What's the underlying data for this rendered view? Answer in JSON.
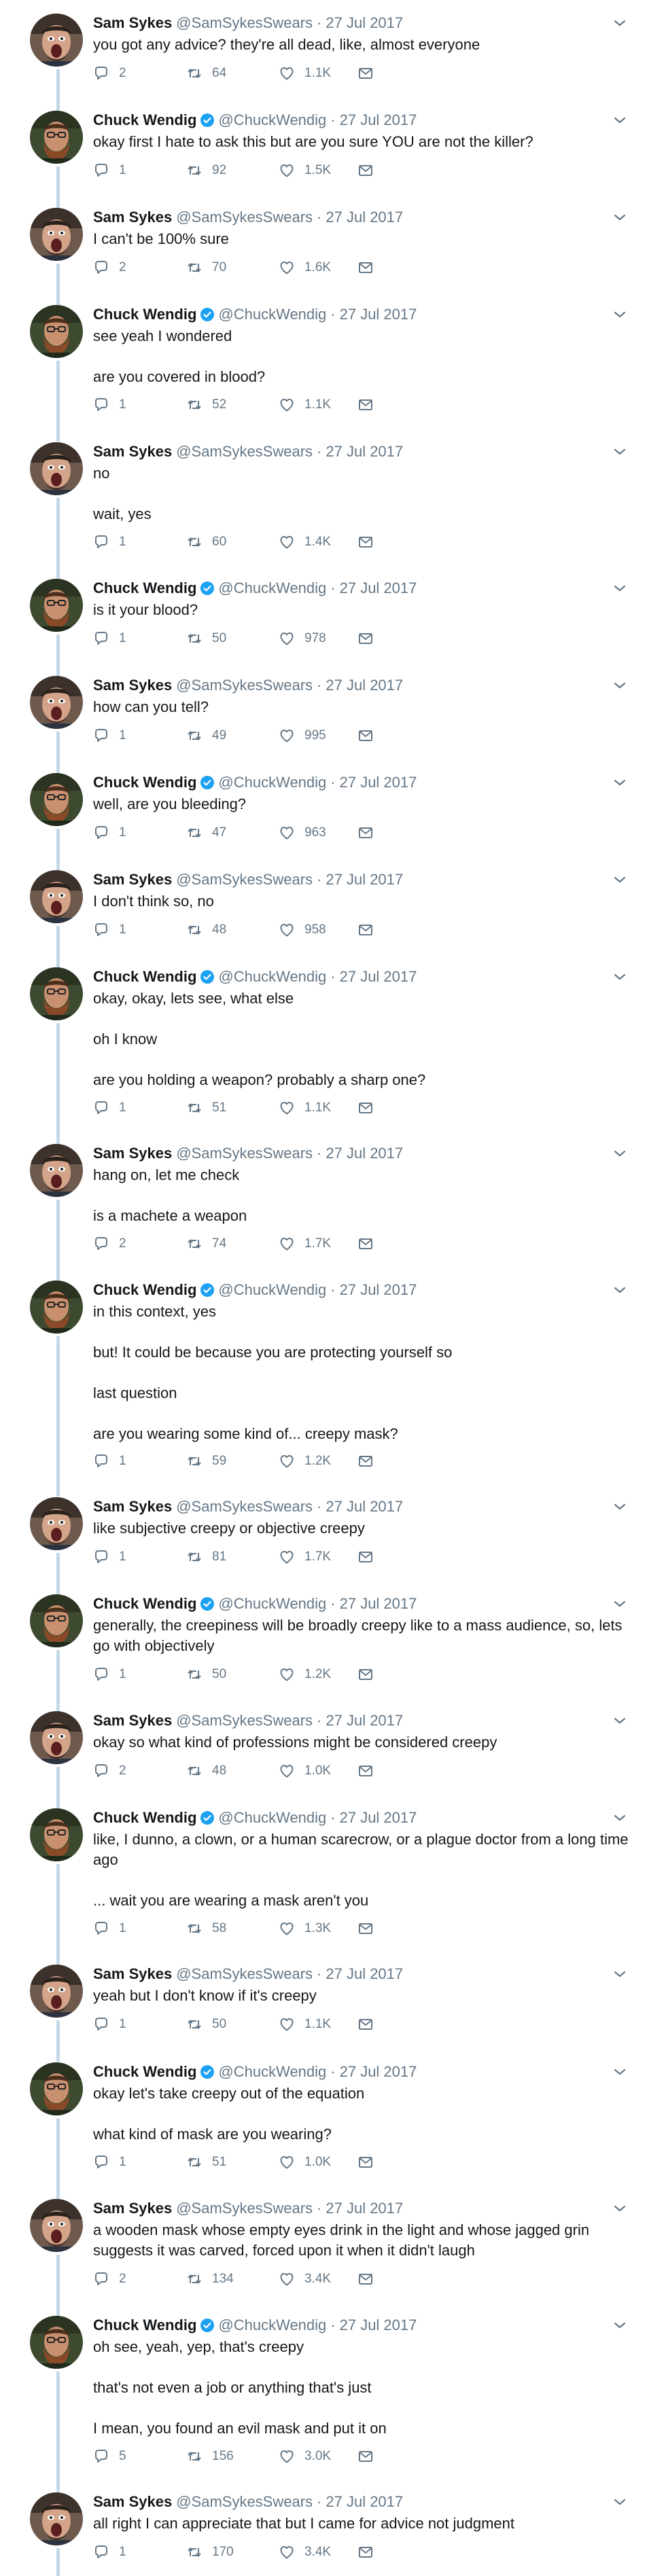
{
  "tweets": [
    {
      "author": "sam",
      "name": "Sam Sykes",
      "handle": "@SamSykesSwears",
      "date": "27 Jul 2017",
      "text": [
        "you got any advice? they're all dead, like, almost everyone"
      ],
      "replies": "2",
      "retweets": "64",
      "likes": "1.1K"
    },
    {
      "author": "chuck",
      "name": "Chuck Wendig",
      "handle": "@ChuckWendig",
      "date": "27 Jul 2017",
      "text": [
        "okay first I hate to ask this but are you sure YOU are not the killer?"
      ],
      "replies": "1",
      "retweets": "92",
      "likes": "1.5K"
    },
    {
      "author": "sam",
      "name": "Sam Sykes",
      "handle": "@SamSykesSwears",
      "date": "27 Jul 2017",
      "text": [
        "I can't be 100% sure"
      ],
      "replies": "2",
      "retweets": "70",
      "likes": "1.6K"
    },
    {
      "author": "chuck",
      "name": "Chuck Wendig",
      "handle": "@ChuckWendig",
      "date": "27 Jul 2017",
      "text": [
        "see yeah I wondered",
        "are you covered in blood?"
      ],
      "replies": "1",
      "retweets": "52",
      "likes": "1.1K"
    },
    {
      "author": "sam",
      "name": "Sam Sykes",
      "handle": "@SamSykesSwears",
      "date": "27 Jul 2017",
      "text": [
        "no",
        "wait, yes"
      ],
      "replies": "1",
      "retweets": "60",
      "likes": "1.4K"
    },
    {
      "author": "chuck",
      "name": "Chuck Wendig",
      "handle": "@ChuckWendig",
      "date": "27 Jul 2017",
      "text": [
        "is it your blood?"
      ],
      "replies": "1",
      "retweets": "50",
      "likes": "978"
    },
    {
      "author": "sam",
      "name": "Sam Sykes",
      "handle": "@SamSykesSwears",
      "date": "27 Jul 2017",
      "text": [
        "how can you tell?"
      ],
      "replies": "1",
      "retweets": "49",
      "likes": "995"
    },
    {
      "author": "chuck",
      "name": "Chuck Wendig",
      "handle": "@ChuckWendig",
      "date": "27 Jul 2017",
      "text": [
        "well, are you bleeding?"
      ],
      "replies": "1",
      "retweets": "47",
      "likes": "963"
    },
    {
      "author": "sam",
      "name": "Sam Sykes",
      "handle": "@SamSykesSwears",
      "date": "27 Jul 2017",
      "text": [
        "I don't think so, no"
      ],
      "replies": "1",
      "retweets": "48",
      "likes": "958"
    },
    {
      "author": "chuck",
      "name": "Chuck Wendig",
      "handle": "@ChuckWendig",
      "date": "27 Jul 2017",
      "text": [
        "okay, okay, lets see, what else",
        "oh I know",
        "are you holding a weapon? probably a sharp one?"
      ],
      "replies": "1",
      "retweets": "51",
      "likes": "1.1K"
    },
    {
      "author": "sam",
      "name": "Sam Sykes",
      "handle": "@SamSykesSwears",
      "date": "27 Jul 2017",
      "text": [
        "hang on, let me check",
        "is a machete a weapon"
      ],
      "replies": "2",
      "retweets": "74",
      "likes": "1.7K"
    },
    {
      "author": "chuck",
      "name": "Chuck Wendig",
      "handle": "@ChuckWendig",
      "date": "27 Jul 2017",
      "text": [
        "in this context, yes",
        "but! It could be because you are protecting yourself so",
        "last question",
        "are you wearing some kind of... creepy mask?"
      ],
      "replies": "1",
      "retweets": "59",
      "likes": "1.2K"
    },
    {
      "author": "sam",
      "name": "Sam Sykes",
      "handle": "@SamSykesSwears",
      "date": "27 Jul 2017",
      "text": [
        "like subjective creepy or objective creepy"
      ],
      "replies": "1",
      "retweets": "81",
      "likes": "1.7K"
    },
    {
      "author": "chuck",
      "name": "Chuck Wendig",
      "handle": "@ChuckWendig",
      "date": "27 Jul 2017",
      "text": [
        "generally, the creepiness will be broadly creepy like to a mass audience, so, lets go with objectively"
      ],
      "replies": "1",
      "retweets": "50",
      "likes": "1.2K"
    },
    {
      "author": "sam",
      "name": "Sam Sykes",
      "handle": "@SamSykesSwears",
      "date": "27 Jul 2017",
      "text": [
        "okay so what kind of professions might be considered creepy"
      ],
      "replies": "2",
      "retweets": "48",
      "likes": "1.0K"
    },
    {
      "author": "chuck",
      "name": "Chuck Wendig",
      "handle": "@ChuckWendig",
      "date": "27 Jul 2017",
      "text": [
        "like, I dunno, a clown, or a human scarecrow, or a plague doctor from a long time ago",
        "... wait you are wearing a mask aren't you"
      ],
      "replies": "1",
      "retweets": "58",
      "likes": "1.3K"
    },
    {
      "author": "sam",
      "name": "Sam Sykes",
      "handle": "@SamSykesSwears",
      "date": "27 Jul 2017",
      "text": [
        "yeah but I don't know if it's creepy"
      ],
      "replies": "1",
      "retweets": "50",
      "likes": "1.1K"
    },
    {
      "author": "chuck",
      "name": "Chuck Wendig",
      "handle": "@ChuckWendig",
      "date": "27 Jul 2017",
      "text": [
        "okay let's take creepy out of the equation",
        "what kind of mask are you wearing?"
      ],
      "replies": "1",
      "retweets": "51",
      "likes": "1.0K"
    },
    {
      "author": "sam",
      "name": "Sam Sykes",
      "handle": "@SamSykesSwears",
      "date": "27 Jul 2017",
      "text": [
        "a wooden mask whose empty eyes drink in the light and whose jagged grin suggests it was carved, forced upon it when it didn't laugh"
      ],
      "replies": "2",
      "retweets": "134",
      "likes": "3.4K"
    },
    {
      "author": "chuck",
      "name": "Chuck Wendig",
      "handle": "@ChuckWendig",
      "date": "27 Jul 2017",
      "text": [
        "oh see, yeah, yep, that's creepy",
        "that's not even a job or anything that's just",
        "I mean, you found an evil mask and put it on"
      ],
      "replies": "5",
      "retweets": "156",
      "likes": "3.0K"
    },
    {
      "author": "sam",
      "name": "Sam Sykes",
      "handle": "@SamSykesSwears",
      "date": "27 Jul 2017",
      "text": [
        "all right I can appreciate that but I came for advice not judgment"
      ],
      "replies": "1",
      "retweets": "170",
      "likes": "3.4K"
    }
  ],
  "icons": {
    "reply": "reply-icon",
    "retweet": "retweet-icon",
    "like": "heart-icon",
    "dm": "envelope-icon",
    "verified": "verified-badge-icon",
    "caret": "chevron-down-icon"
  },
  "colors": {
    "thread_line": "#c4d9e8",
    "verified_blue": "#1da1f2",
    "meta_gray": "#657786",
    "text": "#14171a"
  }
}
